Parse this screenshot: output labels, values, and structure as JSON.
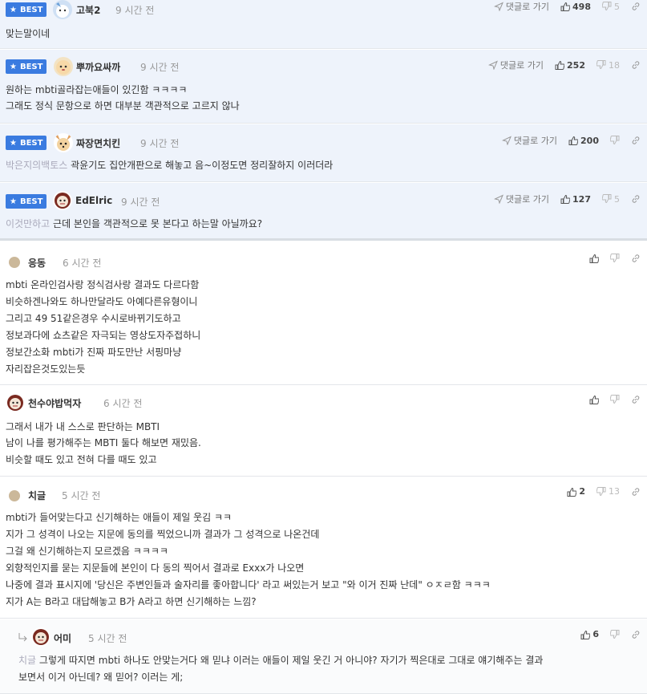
{
  "labels": {
    "best": "BEST",
    "reply_to": "댓글로 가기"
  },
  "comments": [
    {
      "nick": "고북2",
      "time": "9 시간 전",
      "up": "498",
      "down": "5",
      "lines": [
        "맞는말이네"
      ]
    },
    {
      "nick": "뿌까요싸까",
      "time": "9 시간 전",
      "up": "252",
      "down": "18",
      "lines": [
        "원하는 mbti골라잡는애들이 있긴함 ㅋㅋㅋㅋ",
        "그래도 정식 문항으로 하면 대부분 객관적으로 고르지 않나"
      ]
    },
    {
      "nick": "짜장면치킨",
      "time": "9 시간 전",
      "up": "200",
      "down": "",
      "tag": "박은지의백토스",
      "lines": [
        "곽윤기도 집안개판으로 해놓고 음~이정도면 정리잘하지 이러더라"
      ]
    },
    {
      "nick": "EdElric",
      "time": "9 시간 전",
      "up": "127",
      "down": "5",
      "tag": "이것만하고",
      "lines": [
        "근데 본인을 객관적으로 못 본다고 하는말 아닐까요?"
      ]
    },
    {
      "nick": "응동",
      "time": "6 시간 전",
      "up": "",
      "down": "",
      "lines": [
        "mbti 온라인검사랑 정식검사랑 결과도 다르다함",
        "비슷하겐나와도 하나만달라도 아예다른유형이니",
        "그리고 49 51같은경우 수시로바뀌기도하고",
        "정보과다에 쇼츠같은 자극되는 영상도자주접하니",
        "정보간소화 mbti가 진짜 파도만난 서핑마냥",
        "자리잡은것도있는듯"
      ]
    },
    {
      "nick": "천수야밥먹자",
      "time": "6 시간 전",
      "up": "",
      "down": "",
      "lines": [
        "그래서 내가 내 스스로 판단하는 MBTI",
        "남이 나를 평가해주는 MBTI 둘다 해보면 재밌음.",
        "비슷할 때도 있고 전혀 다를 때도 있고"
      ]
    },
    {
      "nick": "치글",
      "time": "5 시간 전",
      "up": "2",
      "down": "13",
      "lines": [
        "mbti가 들어맞는다고 신기해하는 애들이 제일 웃김 ㅋㅋ",
        "지가 그 성격이 나오는 지문에 동의를 찍었으니까 결과가 그 성격으로 나온건데",
        "그걸 왜 신기해하는지 모르겠음 ㅋㅋㅋㅋ",
        "외향적인지를 묻는 지문들에 본인이 다 동의 찍어서 결과로 Exxx가 나오면",
        "나중에 결과 표시지에 '당신은 주변인들과 술자리를 좋아합니다' 라고 써있는거 보고 \"와 이거 진짜 난데\" ㅇㅈㄹ함 ㅋㅋㅋ",
        "지가 A는 B라고 대답해놓고 B가 A라고 하면 신기해하는 느낌?"
      ]
    },
    {
      "nick": "어미",
      "time": "5 시간 전",
      "up": "6",
      "down": "",
      "tag": "치글",
      "lines": [
        "그렇게 따지면 mbti 하나도 안맞는거다 왜 믿냐 이러는 애들이 제일 웃긴 거 아니야? 자기가 찍은대로 그대로 얘기해주는 결과",
        "보면서 이거 아닌데? 왜 믿어? 이러는 게;"
      ]
    }
  ]
}
